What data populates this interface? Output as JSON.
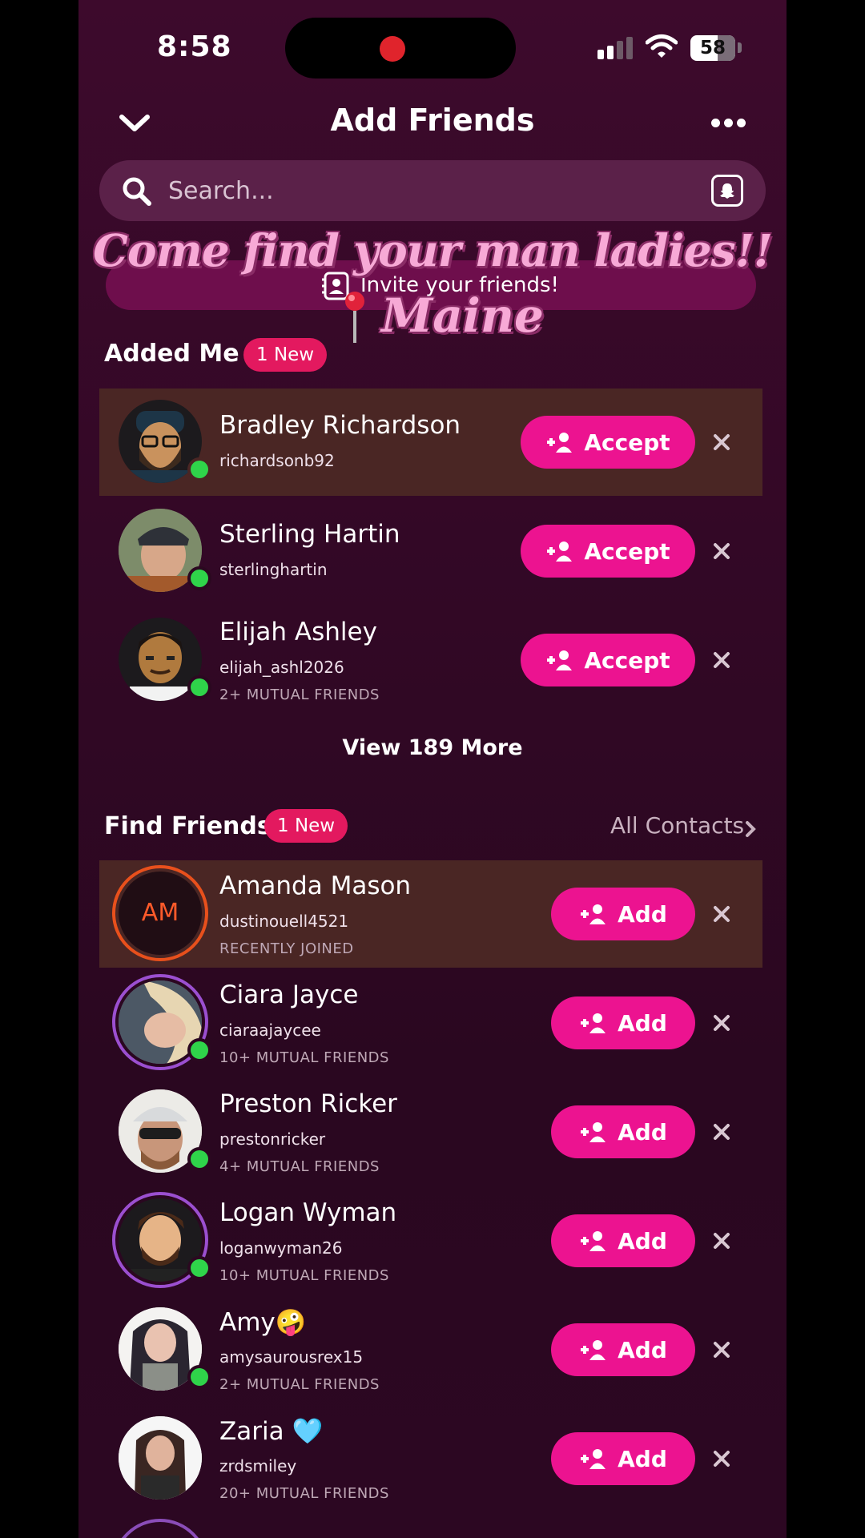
{
  "status_bar": {
    "time": "8:58",
    "battery": "58"
  },
  "header": {
    "title": "Add Friends"
  },
  "search": {
    "placeholder": "Search..."
  },
  "invite": {
    "label": "Invite your friends!"
  },
  "overlay": {
    "line1": "Come find your man ladies!!",
    "line2": "Maine"
  },
  "added_me": {
    "title": "Added Me",
    "badge": "1 New",
    "button_label": "Accept",
    "items": [
      {
        "name": "Bradley Richardson",
        "username": "richardsonb92",
        "sub": ""
      },
      {
        "name": "Sterling Hartin",
        "username": "sterlinghartin",
        "sub": ""
      },
      {
        "name": "Elijah Ashley",
        "username": "elijah_ashl2026",
        "sub": "2+ MUTUAL FRIENDS"
      }
    ],
    "view_more": "View 189 More"
  },
  "find_friends": {
    "title": "Find Friends",
    "badge": "1 New",
    "all_contacts": "All Contacts",
    "button_label": "Add",
    "items": [
      {
        "name": "Amanda Mason",
        "username": "dustinouell4521",
        "sub": "RECENTLY JOINED",
        "initials": "AM"
      },
      {
        "name": "Ciara Jayce",
        "username": "ciaraajaycee",
        "sub": "10+ MUTUAL FRIENDS"
      },
      {
        "name": "Preston Ricker",
        "username": "prestonricker",
        "sub": "4+ MUTUAL FRIENDS"
      },
      {
        "name": "Logan Wyman",
        "username": "loganwyman26",
        "sub": "10+ MUTUAL FRIENDS"
      },
      {
        "name": "Amy🤪",
        "username": "amysaurousrex15",
        "sub": "2+ MUTUAL FRIENDS"
      },
      {
        "name": "Zaria 🩵",
        "username": "zrdsmiley",
        "sub": "20+ MUTUAL FRIENDS"
      }
    ]
  },
  "colors": {
    "accent": "#ec1390",
    "badge": "#e3195f",
    "online": "#2fd44a",
    "highlight_row": "#4a2624"
  }
}
